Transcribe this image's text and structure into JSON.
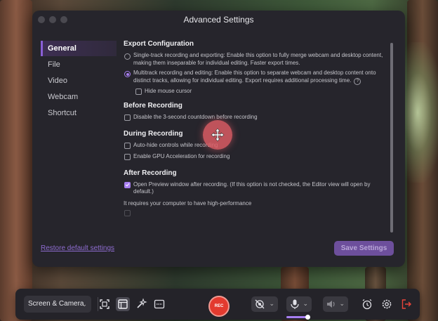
{
  "window": {
    "title": "Advanced Settings"
  },
  "sidebar": {
    "items": [
      {
        "label": "General"
      },
      {
        "label": "File"
      },
      {
        "label": "Video"
      },
      {
        "label": "Webcam"
      },
      {
        "label": "Shortcut"
      }
    ],
    "active": "General",
    "restore_link": "Restore default settings"
  },
  "sections": {
    "export": {
      "title": "Export Configuration",
      "single": "Single-track recording and exporting: Enable this option to fully merge webcam and desktop content, making them inseparable for individual editing. Faster export times.",
      "multi": "Multitrack recording and editing: Enable this option to separate webcam and desktop content onto distinct tracks, allowing for individual editing. Export requires additional processing time.",
      "selected": "multi",
      "hide_cursor": "Hide mouse cursor",
      "hide_cursor_checked": false
    },
    "before": {
      "title": "Before Recording",
      "countdown": "Disable the 3-second countdown before recording",
      "countdown_checked": false
    },
    "during": {
      "title": "During Recording",
      "autohide": "Auto-hide controls while recording",
      "autohide_checked": false,
      "gpu": "Enable GPU Acceleration for recording",
      "gpu_checked": false
    },
    "after": {
      "title": "After Recording",
      "preview": "Open Preview window after recording. (If this option is not checked, the Editor view will open by default.)",
      "preview_checked": true,
      "note": "It requires your computer to have high-performance"
    }
  },
  "save_button": "Save Settings",
  "toolbar": {
    "source": "Screen & Camera",
    "record": "REC"
  },
  "colors": {
    "accent": "#a77ef0",
    "record": "#e33a2f",
    "window_bg": "#26252c"
  }
}
